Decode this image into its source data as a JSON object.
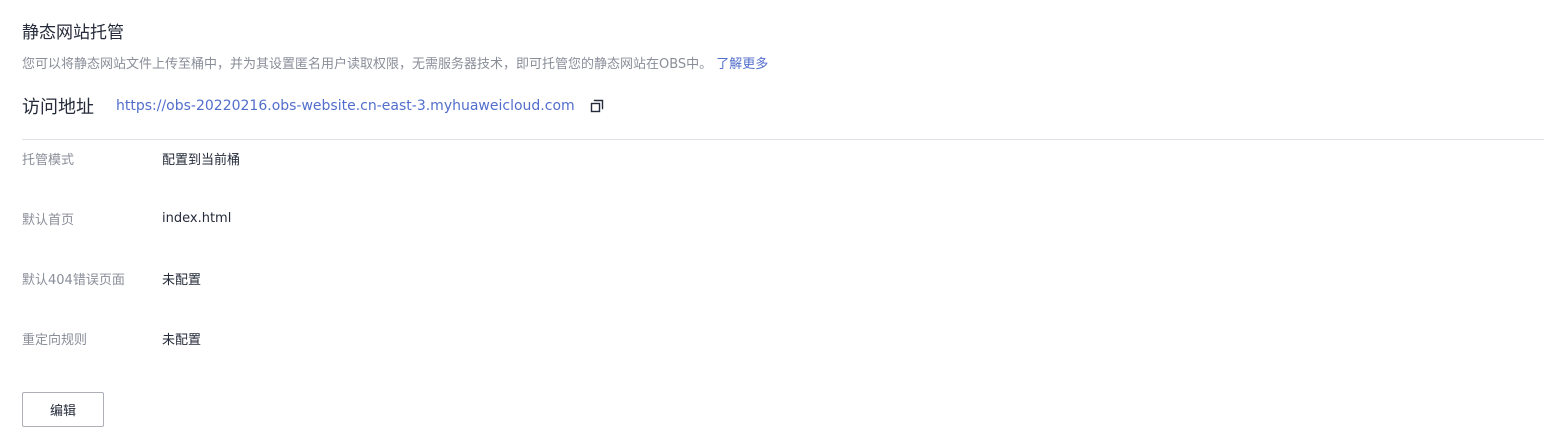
{
  "header": {
    "title": "静态网站托管",
    "description": "您可以将静态网站文件上传至桶中，并为其设置匿名用户读取权限，无需服务器技术，即可托管您的静态网站在OBS中。",
    "learn_more": "了解更多"
  },
  "access": {
    "label": "访问地址",
    "url": "https://obs-20220216.obs-website.cn-east-3.myhuaweicloud.com",
    "copy_icon": "copy-icon"
  },
  "fields": [
    {
      "label": "托管模式",
      "value": "配置到当前桶"
    },
    {
      "label": "默认首页",
      "value": "index.html"
    },
    {
      "label": "默认404错误页面",
      "value": "未配置"
    },
    {
      "label": "重定向规则",
      "value": "未配置"
    }
  ],
  "actions": {
    "edit_label": "编辑"
  },
  "colors": {
    "link": "#526ecc",
    "muted": "#8a8e99",
    "text": "#252b3a",
    "divider": "#dfe1e6"
  }
}
